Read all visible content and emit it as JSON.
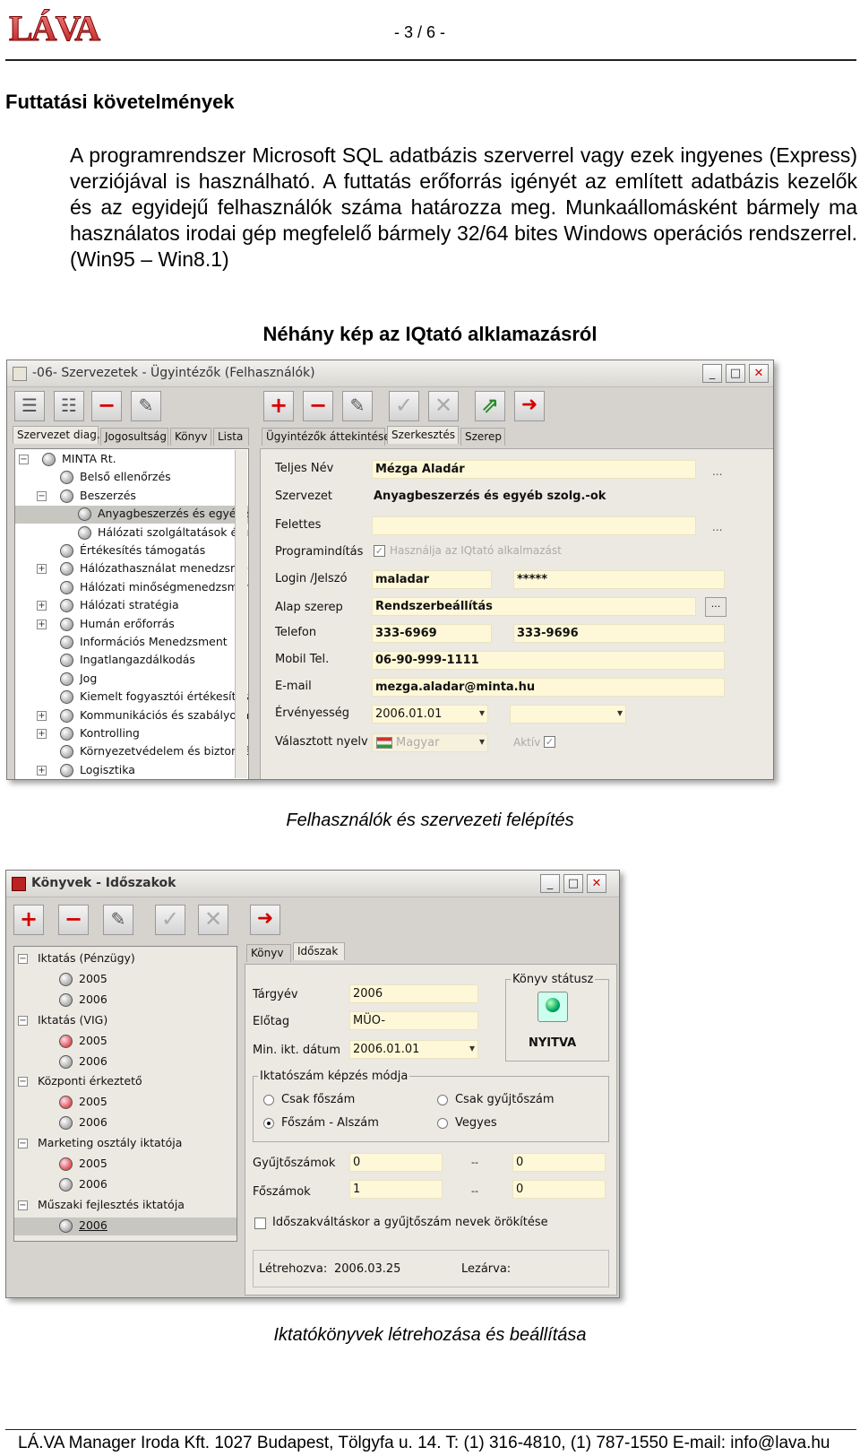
{
  "header": {
    "page_number": "- 3 / 6 -",
    "logo_text": "LÁVA"
  },
  "section": {
    "heading": "Futtatási követelmények",
    "paragraph": "A programrendszer Microsoft SQL adatbázis szerverrel vagy ezek ingyenes (Express) verziójával is használható. A futtatás erőforrás igényét az említett adatbázis kezelők és az egyidejű felhasználók száma határozza meg. Munkaállomásként bármely ma használatos irodai gép megfelelő bármely 32/64 bites Windows operációs rendszerrel. (Win95 – Win8.1)",
    "images_title": "Néhány kép az IQtató alklamazásról"
  },
  "window1": {
    "title": "-06- Szervezetek - Ügyintézők  (Felhasználók)",
    "left_tabs": [
      "Szervezet diag.",
      "Jogosultság",
      "Könyv",
      "Lista"
    ],
    "right_tabs": [
      "Ügyintézők áttekintése",
      "Szerkesztés",
      "Szerep"
    ],
    "tree": [
      {
        "label": "MINTA Rt.",
        "level": 0,
        "exp": "−"
      },
      {
        "label": "Belső ellenőrzés",
        "level": 1,
        "exp": ""
      },
      {
        "label": "Beszerzés",
        "level": 1,
        "exp": "−"
      },
      {
        "label": "Anyagbeszerzés és egyéb szolg.",
        "level": 2,
        "exp": "",
        "selected": true
      },
      {
        "label": "Hálózati szolgáltatások és nagy",
        "level": 2,
        "exp": ""
      },
      {
        "label": "Értékesítés támogatás",
        "level": 1,
        "exp": ""
      },
      {
        "label": "Hálózathasználat menedzsment",
        "level": 1,
        "exp": "+"
      },
      {
        "label": "Hálózati minőségmenedzsment",
        "level": 1,
        "exp": ""
      },
      {
        "label": "Hálózati stratégia",
        "level": 1,
        "exp": "+"
      },
      {
        "label": "Humán erőforrás",
        "level": 1,
        "exp": "+"
      },
      {
        "label": "Információs Menedzsment",
        "level": 1,
        "exp": ""
      },
      {
        "label": "Ingatlangazdálkodás",
        "level": 1,
        "exp": ""
      },
      {
        "label": "Jog",
        "level": 1,
        "exp": ""
      },
      {
        "label": "Kiemelt fogyasztói értékesítés",
        "level": 1,
        "exp": ""
      },
      {
        "label": "Kommunikációs és szabályozás m",
        "level": 1,
        "exp": "+"
      },
      {
        "label": "Kontrolling",
        "level": 1,
        "exp": "+"
      },
      {
        "label": "Környezetvédelem és biztonságte",
        "level": 1,
        "exp": ""
      },
      {
        "label": "Logisztika",
        "level": 1,
        "exp": "+"
      }
    ],
    "form": {
      "full_name_label": "Teljes Név",
      "full_name": "Mézga Aladár",
      "org_label": "Szervezet",
      "org": "Anyagbeszerzés és egyéb szolg.-ok",
      "superior_label": "Felettes",
      "superior": "",
      "program_start_label": "Programindítás",
      "program_start_check": "Használja az IQtató alkalmazást",
      "login_label": "Login /Jelszó",
      "login": "maladar",
      "password": "*****",
      "role_label": "Alap szerep",
      "role": "Rendszerbeállítás",
      "phone_label": "Telefon",
      "phone1": "333-6969",
      "phone2": "333-9696",
      "mobile_label": "Mobil Tel.",
      "mobile": "06-90-999-1111",
      "email_label": "E-mail",
      "email": "mezga.aladar@minta.hu",
      "validity_label": "Érvényesség",
      "validity_from": "2006.01.01",
      "validity_to": "",
      "language_label": "Választott nyelv",
      "language": "Magyar",
      "active_label": "Aktív",
      "ellipsis": "..."
    }
  },
  "caption1": "Felhasználók és szervezeti felépítés",
  "window2": {
    "title": "Könyvek - Időszakok",
    "tabs": [
      "Könyv",
      "Időszak"
    ],
    "tree": [
      {
        "label": "Iktatás (Pénzügy)",
        "level": 0,
        "exp": "−"
      },
      {
        "label": "2005",
        "level": 1,
        "led": "gray"
      },
      {
        "label": "2006",
        "level": 1,
        "led": "gray"
      },
      {
        "label": "Iktatás (VIG)",
        "level": 0,
        "exp": "−"
      },
      {
        "label": "2005",
        "level": 1,
        "led": "red"
      },
      {
        "label": "2006",
        "level": 1,
        "led": "gray"
      },
      {
        "label": "Központi érkeztető",
        "level": 0,
        "exp": "−"
      },
      {
        "label": "2005",
        "level": 1,
        "led": "red"
      },
      {
        "label": "2006",
        "level": 1,
        "led": "gray"
      },
      {
        "label": "Marketing osztály iktatója",
        "level": 0,
        "exp": "−"
      },
      {
        "label": "2005",
        "level": 1,
        "led": "red"
      },
      {
        "label": "2006",
        "level": 1,
        "led": "gray"
      },
      {
        "label": "Műszaki fejlesztés iktatója",
        "level": 0,
        "exp": "−"
      },
      {
        "label": "2006",
        "level": 1,
        "led": "gray",
        "selected": true
      }
    ],
    "form": {
      "year_label": "Tárgyév",
      "year": "2006",
      "prefix_label": "Előtag",
      "prefix": "MÜO-",
      "min_date_label": "Min. ikt. dátum",
      "min_date": "2006.01.01",
      "status_group": "Könyv státusz",
      "status": "NYITVA",
      "mode_group": "Iktatószám képzés módja",
      "opt1": "Csak főszám",
      "opt2": "Csak gyűjtőszám",
      "opt3": "Főszám - Alszám",
      "opt4": "Vegyes",
      "collect_label": "Gyűjtőszámok",
      "collect_from": "0",
      "collect_to": "0",
      "main_label": "Főszámok",
      "main_from": "1",
      "main_to": "0",
      "range_sep": "--",
      "inherit_label": "Időszakváltáskor a gyűjtőszám nevek örökítése",
      "created_label": "Létrehozva:",
      "created": "2006.03.25",
      "closed_label": "Lezárva:",
      "closed": ""
    }
  },
  "caption2": "Iktatókönyvek létrehozása és beállítása",
  "footer": "LÁ.VA Manager Iroda Kft.  1027 Budapest, Tölgyfa u. 14. T: (1) 316-4810, (1) 787-1550   E-mail: info@lava.hu"
}
